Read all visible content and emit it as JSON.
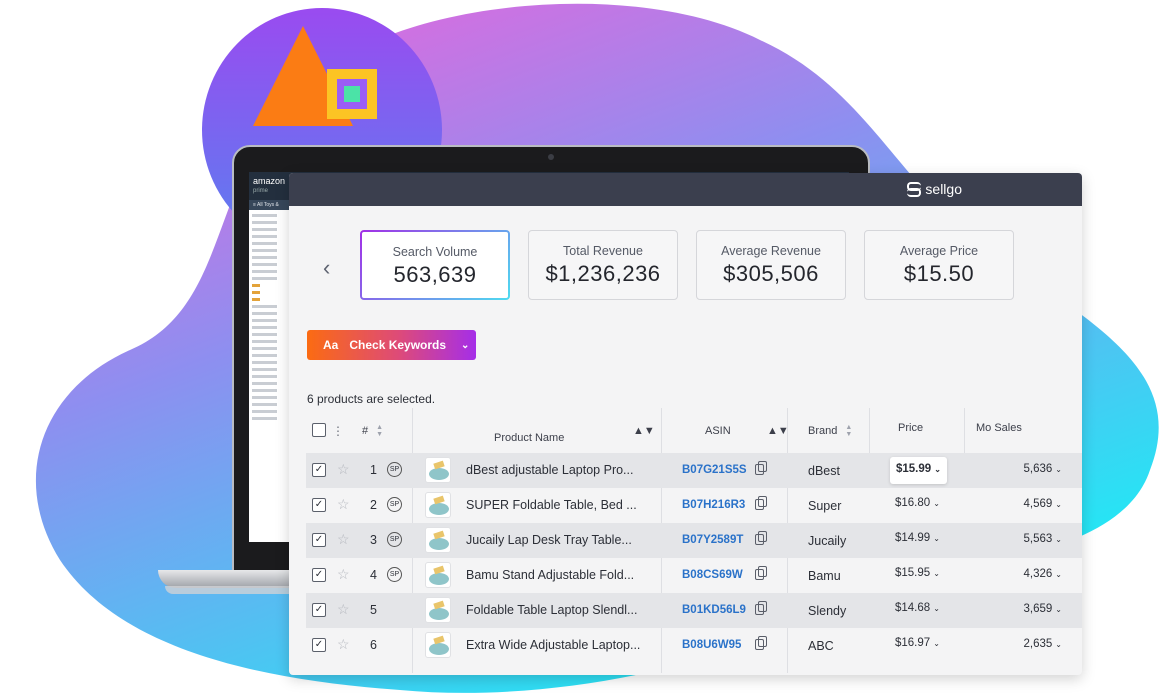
{
  "colors": {
    "accent_gradient_start": "#fb6b12",
    "accent_gradient_end": "#a52ee8",
    "header_bg": "#3b3f4e",
    "link": "#2a72c9"
  },
  "laptop_screen": {
    "amazon_logo": "amazon",
    "amazon_tagline": "prime",
    "amazon_nav": "≡ All  Toys &"
  },
  "brand": {
    "logo_text": "sellgo"
  },
  "stats": [
    {
      "label": "Search Volume",
      "value": "563,639"
    },
    {
      "label": "Total Revenue",
      "value": "$1,236,236"
    },
    {
      "label": "Average Revenue",
      "value": "$305,506"
    },
    {
      "label": "Average Price",
      "value": "$15.50"
    }
  ],
  "keyword_button": {
    "prefix": "Aa",
    "label": "Check Keywords"
  },
  "selection_text": "6 products are selected.",
  "table": {
    "headers": {
      "num": "#",
      "product": "Product Name",
      "asin": "ASIN",
      "brand": "Brand",
      "price": "Price",
      "sales": "Mo Sales"
    },
    "sp_badge": "SP",
    "rows": [
      {
        "num": "1",
        "sp": true,
        "name": "dBest adjustable Laptop Pro...",
        "asin": "B07G21S5S",
        "brand": "dBest",
        "price": "$15.99",
        "sales": "5,636"
      },
      {
        "num": "2",
        "sp": true,
        "name": "SUPER Foldable Table, Bed ...",
        "asin": "B07H216R3",
        "brand": "Super",
        "price": "$16.80",
        "sales": "4,569"
      },
      {
        "num": "3",
        "sp": true,
        "name": "Jucaily Lap Desk Tray Table...",
        "asin": "B07Y2589T",
        "brand": "Jucaily",
        "price": "$14.99",
        "sales": "5,563"
      },
      {
        "num": "4",
        "sp": true,
        "name": "Bamu Stand Adjustable Fold...",
        "asin": "B08CS69W",
        "brand": "Bamu",
        "price": "$15.95",
        "sales": "4,326"
      },
      {
        "num": "5",
        "sp": false,
        "name": "Foldable Table Laptop Slendl...",
        "asin": "B01KD56L9",
        "brand": "Slendy",
        "price": "$14.68",
        "sales": "3,659"
      },
      {
        "num": "6",
        "sp": false,
        "name": "Extra Wide Adjustable Laptop...",
        "asin": "B08U6W95",
        "brand": "ABC",
        "price": "$16.97",
        "sales": "2,635"
      }
    ]
  }
}
